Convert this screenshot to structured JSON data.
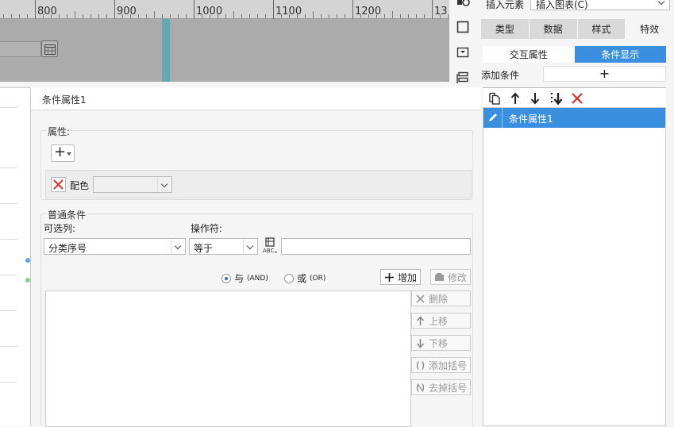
{
  "ruler": {
    "labels": [
      "800",
      "900",
      "1000",
      "1100",
      "1200",
      "13"
    ]
  },
  "dialog": {
    "title": "条件属性1",
    "property_group": {
      "legend": "属性:",
      "add_button": "+",
      "color_label": "配色"
    },
    "condition_group": {
      "legend": "普通条件",
      "column_label": "可选列:",
      "column_value": "分类序号",
      "operator_label": "操作符:",
      "operator_value": "等于",
      "value_input": "",
      "and_label": "与",
      "and_sub": "(AND)",
      "or_label": "或",
      "or_sub": "(OR)",
      "and_selected": true,
      "add_btn": "增加",
      "modify_btn": "修改",
      "delete_btn": "删除",
      "move_up_btn": "上移",
      "move_down_btn": "下移",
      "add_bracket_btn": "添加括号",
      "remove_bracket_btn": "去掉括号"
    }
  },
  "right_panel": {
    "insert_label": "插入元素",
    "insert_value": "插入图表(C)",
    "main_tabs": [
      "类型",
      "数据",
      "样式",
      "特效"
    ],
    "active_main_tab": "特效",
    "sub_tabs": [
      "交互属性",
      "条件显示"
    ],
    "active_sub_tab": "条件显示",
    "add_condition_label": "添加条件",
    "add_condition_btn": "+",
    "conditions": [
      "条件属性1"
    ]
  },
  "colors": {
    "accent": "#3b8fe0",
    "canvas_gray": "#ababab",
    "teal_marker": "#62a8b6",
    "delete_red": "#e0302b"
  }
}
